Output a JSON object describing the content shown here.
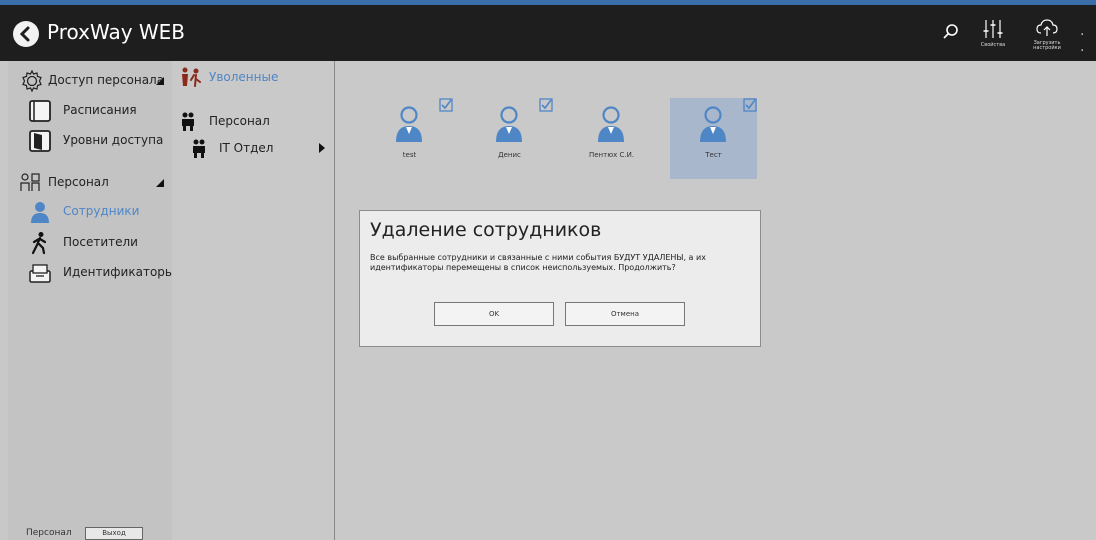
{
  "app": {
    "title": "ProxWay WEB"
  },
  "toolbar": {
    "settings_label": "Свойства",
    "upload_label": "Загрузить настройки",
    "more_label": ". ."
  },
  "sidebar": {
    "groups": [
      {
        "label": "Доступ персонала",
        "icon": "gear-icon"
      },
      {
        "label": "Персонал",
        "icon": "people-tree-icon"
      }
    ],
    "items": [
      {
        "label": "Расписания",
        "icon": "calendar-icon"
      },
      {
        "label": "Уровни доступа",
        "icon": "door-icon"
      },
      {
        "label": "Сотрудники",
        "icon": "employee-icon",
        "active": true
      },
      {
        "label": "Посетители",
        "icon": "walking-person-icon"
      },
      {
        "label": "Идентификаторы",
        "icon": "card-box-icon"
      }
    ],
    "footer": {
      "label": "Персонал",
      "exit_label": "Выход"
    }
  },
  "tree": {
    "fired_label": "Уволенные",
    "nodes": [
      {
        "label": "Персонал"
      },
      {
        "label": "IT Отдел"
      }
    ]
  },
  "employees": [
    {
      "name": "test",
      "checked": true,
      "selected": false
    },
    {
      "name": "Денис",
      "checked": true,
      "selected": false
    },
    {
      "name": "Пентюх С.И.",
      "checked": false,
      "selected": false
    },
    {
      "name": "Тест",
      "checked": true,
      "selected": true
    }
  ],
  "dialog": {
    "title": "Удаление сотрудников",
    "message": "Все выбранные сотрудники и связанные с ними события БУДУТ УДАЛЕНЫ, а их идентификаторы перемещены в список неиспользуемых. Продолжить?",
    "ok_label": "OK",
    "cancel_label": "Отмена"
  },
  "colors": {
    "topbar": "#1e1e1e",
    "accent_blue": "#4f86c6",
    "selected_tile": "#a9b7cc"
  }
}
